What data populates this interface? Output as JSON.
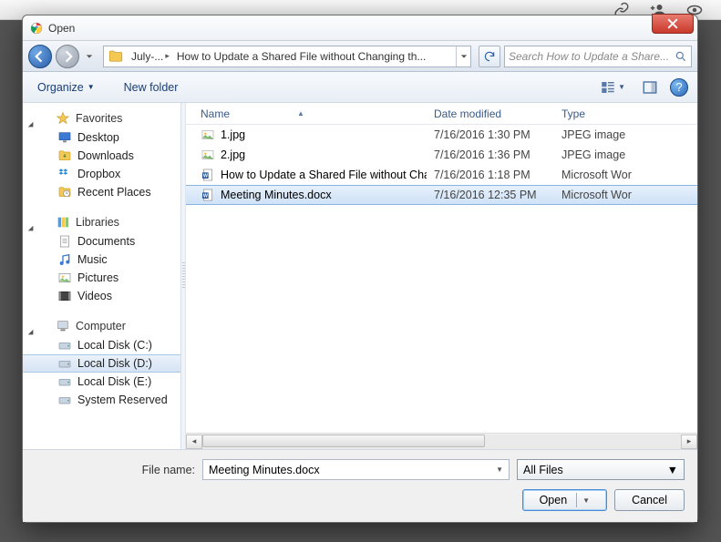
{
  "dialog_title": "Open",
  "breadcrumb": {
    "seg1": "July-...",
    "seg2": "How to Update a Shared File without Changing th..."
  },
  "search_placeholder": "Search How to Update a Share...",
  "cmdbar": {
    "organize": "Organize",
    "newfolder": "New folder"
  },
  "columns": {
    "name": "Name",
    "date": "Date modified",
    "type": "Type"
  },
  "nav": {
    "favorites": "Favorites",
    "favorites_items": [
      "Desktop",
      "Downloads",
      "Dropbox",
      "Recent Places"
    ],
    "libraries": "Libraries",
    "libraries_items": [
      "Documents",
      "Music",
      "Pictures",
      "Videos"
    ],
    "computer": "Computer",
    "computer_items": [
      "Local Disk (C:)",
      "Local Disk (D:)",
      "Local Disk (E:)",
      "System Reserved"
    ]
  },
  "files": [
    {
      "name": "1.jpg",
      "date": "7/16/2016 1:30 PM",
      "type": "JPEG image",
      "kind": "jpg"
    },
    {
      "name": "2.jpg",
      "date": "7/16/2016 1:36 PM",
      "type": "JPEG image",
      "kind": "jpg"
    },
    {
      "name": "How to Update a Shared File without Cha...",
      "date": "7/16/2016 1:18 PM",
      "type": "Microsoft Wor",
      "kind": "docx"
    },
    {
      "name": "Meeting Minutes.docx",
      "date": "7/16/2016 12:35 PM",
      "type": "Microsoft Wor",
      "kind": "docx"
    }
  ],
  "selected_index": 3,
  "footer": {
    "filename_label": "File name:",
    "filename_value": "Meeting Minutes.docx",
    "filter": "All Files",
    "open": "Open",
    "cancel": "Cancel"
  }
}
